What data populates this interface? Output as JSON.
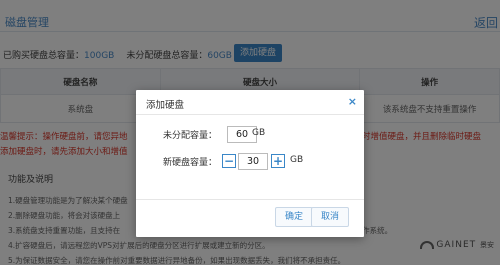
{
  "page": {
    "title": "磁盘管理",
    "back_label": "返回",
    "purchased_label": "已购买硬盘总容量：",
    "purchased_value": "100GB",
    "unallocated_label": "未分配硬盘总容量：",
    "unallocated_value": "60GB",
    "add_button_label": "添加硬盘"
  },
  "table": {
    "headers": [
      "硬盘名称",
      "硬盘大小",
      "操作"
    ],
    "rows": [
      [
        "系统盘",
        "",
        "该系统盘不支持重置操作"
      ]
    ]
  },
  "warning": {
    "line1": "温馨提示：操作硬盘前，请您异地",
    "line1_tail": "临时增值硬盘，并且删除临时硬盘",
    "line2": "添加硬盘时，请先添加大小和增值"
  },
  "help": {
    "title": "功能及说明",
    "items": [
      "1.硬盘管理功能是为了解决某个硬盘",
      "2.删除硬盘功能，将会对该硬盘上",
      "3.系统盘支持重置功能，且支持在",
      "4.扩容硬盘后，请远程您的VPS对扩展后的硬盘分区进行扩展或建立新的分区。",
      "5.为保证数据安全，请您在操作前对重要数据进行异地备份，如果出现数据丢失，我们将不承担责任。"
    ],
    "item3_tail": "余操作系统。"
  },
  "brand": {
    "name": "GAINET",
    "sub": "景安"
  },
  "modal": {
    "title": "添加硬盘",
    "close_symbol": "×",
    "unallocated_label": "未分配容量：",
    "unallocated_value": "60",
    "unallocated_unit": "GB",
    "new_disk_label": "新硬盘容量：",
    "new_disk_value": "30",
    "new_disk_unit": "GB",
    "minus_symbol": "−",
    "plus_symbol": "+",
    "confirm_label": "确定",
    "cancel_label": "取消"
  },
  "colors": {
    "accent": "#3a87c8",
    "warning": "#d9372b",
    "overlay": "rgba(0,0,0,0.5)"
  },
  "icons": {
    "close": "close-icon",
    "minus": "minus-icon",
    "plus": "plus-icon",
    "brand_logo": "gainet-logo-icon"
  }
}
